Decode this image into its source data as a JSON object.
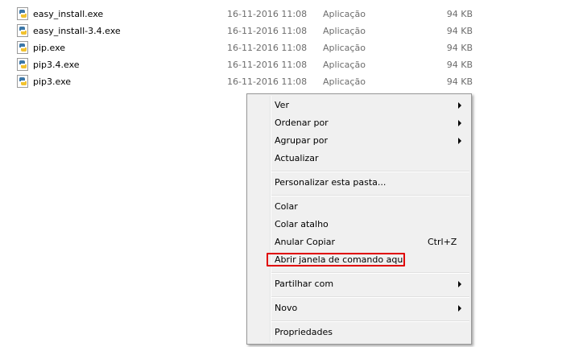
{
  "files": [
    {
      "name": "easy_install.exe",
      "date": "16-11-2016 11:08",
      "type": "Aplicação",
      "size": "94 KB",
      "icon": "python-exe-icon"
    },
    {
      "name": "easy_install-3.4.exe",
      "date": "16-11-2016 11:08",
      "type": "Aplicação",
      "size": "94 KB",
      "icon": "python-exe-icon"
    },
    {
      "name": "pip.exe",
      "date": "16-11-2016 11:08",
      "type": "Aplicação",
      "size": "94 KB",
      "icon": "python-exe-icon"
    },
    {
      "name": "pip3.4.exe",
      "date": "16-11-2016 11:08",
      "type": "Aplicação",
      "size": "94 KB",
      "icon": "python-exe-icon"
    },
    {
      "name": "pip3.exe",
      "date": "16-11-2016 11:08",
      "type": "Aplicação",
      "size": "94 KB",
      "icon": "python-exe-icon"
    }
  ],
  "context_menu": {
    "ver": "Ver",
    "ordenar_por": "Ordenar por",
    "agrupar_por": "Agrupar por",
    "actualizar": "Actualizar",
    "personalizar": "Personalizar esta pasta...",
    "colar": "Colar",
    "colar_atalho": "Colar atalho",
    "anular_copiar": "Anular Copiar",
    "anular_copiar_shortcut": "Ctrl+Z",
    "abrir_janela": "Abrir janela de comando aqui",
    "partilhar_com": "Partilhar com",
    "novo": "Novo",
    "propriedades": "Propriedades"
  },
  "colors": {
    "highlight_border": "#e00000",
    "menu_background": "#f0f0f0",
    "secondary_text": "#6d6d6d"
  }
}
